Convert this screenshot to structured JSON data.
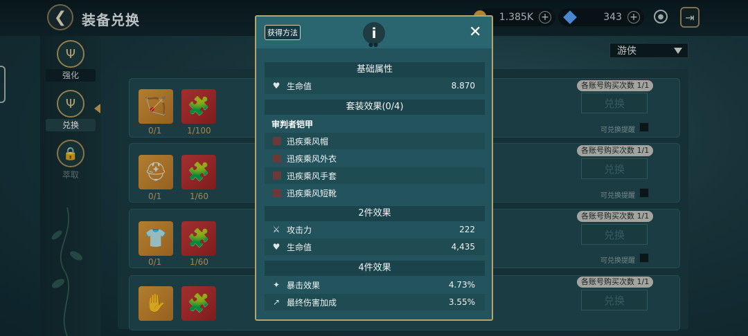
{
  "header": {
    "back_icon": "back-arrow-icon",
    "title": "装备兑换",
    "gold_amount": "1.385K",
    "gem_amount": "343"
  },
  "nav": {
    "items": [
      {
        "label": "强化",
        "icon": "trident-icon"
      },
      {
        "label": "兑换",
        "icon": "trident-icon"
      },
      {
        "label": "萃取",
        "icon": "lock-icon"
      }
    ]
  },
  "filter": {
    "class_value": "游侠"
  },
  "list": {
    "rows": [
      {
        "count_a": "0/1",
        "count_b": "1/100",
        "limit": "各账号购买次数 1/1",
        "button": "兑换",
        "remind": "可兑换提醒"
      },
      {
        "count_a": "0/1",
        "count_b": "1/60",
        "limit": "各账号购买次数 1/1",
        "button": "兑换",
        "remind": "可兑换提醒"
      },
      {
        "count_a": "0/1",
        "count_b": "1/60",
        "limit": "各账号购买次数 1/1",
        "button": "兑换",
        "remind": "可兑换提醒"
      },
      {
        "count_a": "",
        "count_b": "",
        "limit": "各账号购买次数 1/1",
        "button": "兑换",
        "remind": ""
      }
    ]
  },
  "modal": {
    "source_button": "获得方法",
    "base_title": "基础属性",
    "base_stats": [
      {
        "name": "生命值",
        "value": "8.870",
        "icon": "heart-icon"
      }
    ],
    "set_title": "套装效果(0/4)",
    "set_name": "审判者铠甲",
    "set_pieces": [
      "迅疾乘风帽",
      "迅疾乘风外衣",
      "迅疾乘风手套",
      "迅疾乘风短靴"
    ],
    "two_piece_title": "2件效果",
    "two_piece": [
      {
        "name": "攻击力",
        "value": "222",
        "icon": "crossed-swords-icon"
      },
      {
        "name": "生命值",
        "value": "4,435",
        "icon": "heart-icon"
      }
    ],
    "four_piece_title": "4件效果",
    "four_piece": [
      {
        "name": "暴击效果",
        "value": "4.73%",
        "icon": "crit-icon"
      },
      {
        "name": "最终伤害加成",
        "value": "3.55%",
        "icon": "damage-up-icon"
      }
    ]
  }
}
